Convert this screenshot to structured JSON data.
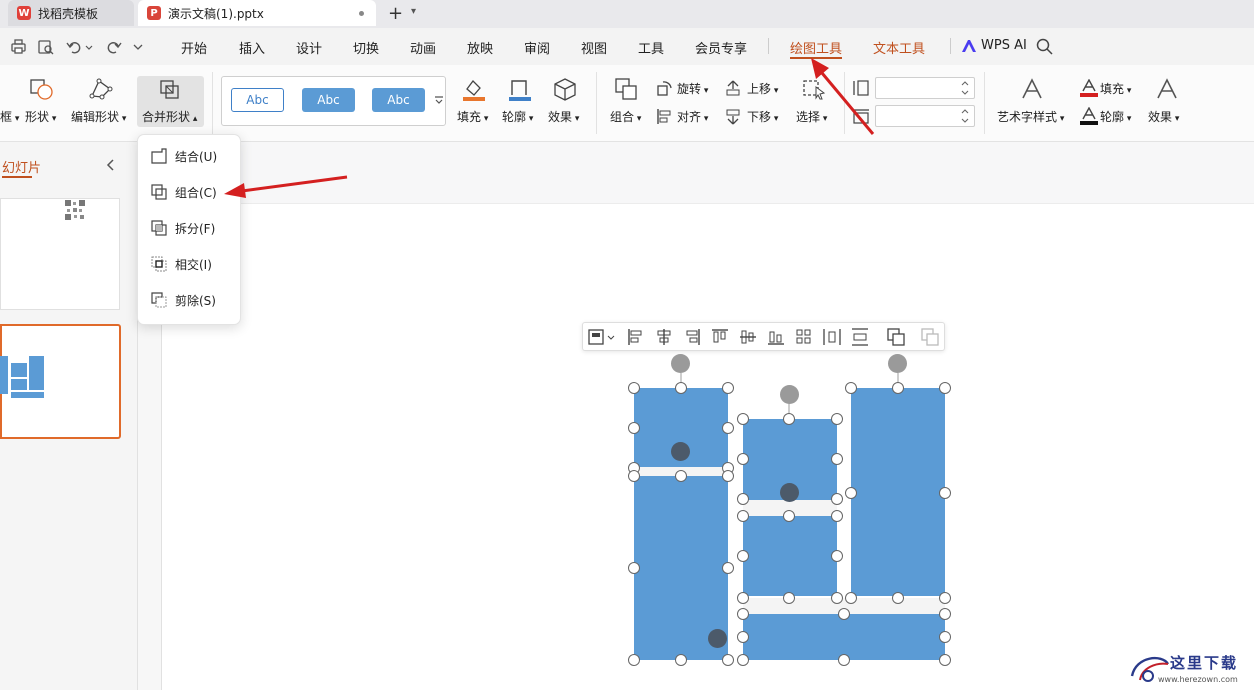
{
  "tabs": [
    {
      "label": "找稻壳模板",
      "logo": "W"
    },
    {
      "label": "演示文稿(1).pptx",
      "logo": "P"
    }
  ],
  "menu": {
    "items": [
      "开始",
      "插入",
      "设计",
      "切换",
      "动画",
      "放映",
      "审阅",
      "视图",
      "工具",
      "会员专享"
    ],
    "context_tabs": [
      "绘图工具",
      "文本工具"
    ],
    "wps_ai": "WPS AI"
  },
  "ribbon": {
    "frag_label": "框",
    "shape_label": "形状",
    "edit_shape_label": "编辑形状",
    "merge_shape_label": "合并形状",
    "style_samples": [
      "Abc",
      "Abc",
      "Abc"
    ],
    "fill_label": "填充",
    "outline_label": "轮廓",
    "effect_label": "效果",
    "group_label": "组合",
    "rotate_label": "旋转",
    "align_label": "对齐",
    "up_label": "上移",
    "down_label": "下移",
    "select_label": "选择",
    "art_style_label": "艺术字样式",
    "text_fill_label": "填充",
    "text_outline_label": "轮廓",
    "text_effect_label": "效果"
  },
  "merge_menu": [
    {
      "label": "结合(U)",
      "icon": "union-icon"
    },
    {
      "label": "组合(C)",
      "icon": "combine-icon"
    },
    {
      "label": "拆分(F)",
      "icon": "fragment-icon"
    },
    {
      "label": "相交(I)",
      "icon": "intersect-icon"
    },
    {
      "label": "剪除(S)",
      "icon": "subtract-icon"
    }
  ],
  "left_panel": {
    "title": "幻灯片"
  },
  "watermark": {
    "text": "这里下载",
    "url_text": "www.herezown.com"
  },
  "colors": {
    "accent": "#c0501e",
    "shape_fill": "#5b9bd5",
    "annotation_arrow": "#d42020",
    "selection_border": "#e06a2a"
  }
}
